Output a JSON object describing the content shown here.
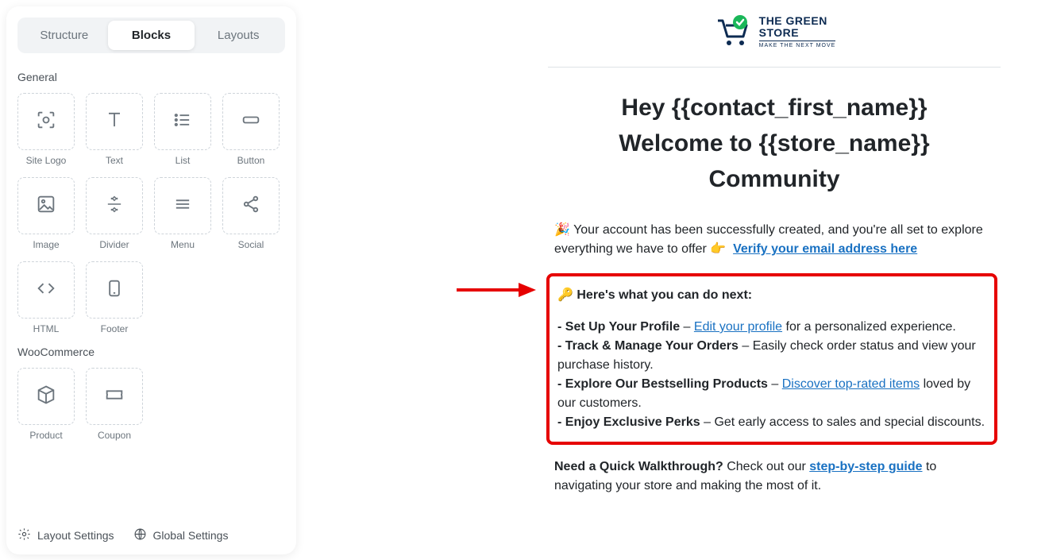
{
  "tabs": {
    "structure": "Structure",
    "blocks": "Blocks",
    "layouts": "Layouts"
  },
  "sections": {
    "general": "General",
    "woo": "WooCommerce"
  },
  "blocks": {
    "site_logo": "Site Logo",
    "text": "Text",
    "list": "List",
    "button": "Button",
    "image": "Image",
    "divider": "Divider",
    "menu": "Menu",
    "social": "Social",
    "html": "HTML",
    "footer": "Footer",
    "product": "Product",
    "coupon": "Coupon"
  },
  "footer_links": {
    "layout": "Layout Settings",
    "global": "Global Settings"
  },
  "preview": {
    "logo": {
      "line1": "THE GREEN",
      "line2": "STORE",
      "tag": "MAKE THE NEXT MOVE"
    },
    "headline_l1": "Hey {{contact_first_name}}",
    "headline_l2": "Welcome to {{store_name}}",
    "headline_l3": "Community",
    "intro_before": " Your account has been successfully created, and you're all set to explore everything we have to offer ",
    "intro_link": "Verify your email address here",
    "callout_lead": " Here's what you can do next:",
    "items": {
      "i1_b": "- Set Up Your Profile",
      "i1_mid": " – ",
      "i1_link": "Edit your profile",
      "i1_after": " for a personalized experience.",
      "i2_b": "- Track & Manage Your Orders",
      "i2_after": " – Easily check order status and view your purchase history.",
      "i3_b": "- Explore Our Bestselling Products",
      "i3_mid": " – ",
      "i3_link": "Discover top-rated items",
      "i3_after": " loved by our customers.",
      "i4_b": "- Enjoy Exclusive Perks",
      "i4_after": " – Get early access to sales and special discounts."
    },
    "walk_b": "Need a Quick Walkthrough?",
    "walk_before": " Check out our ",
    "walk_link": "step-by-step guide",
    "walk_after": " to navigating your store and making the most of it."
  }
}
